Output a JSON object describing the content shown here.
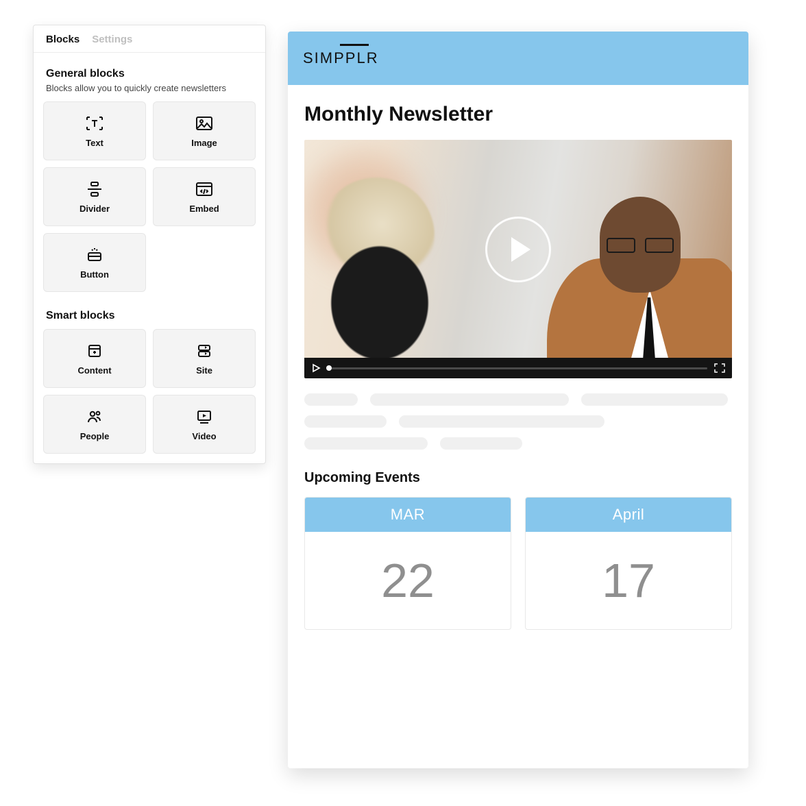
{
  "sidebar": {
    "tabs": {
      "blocks": "Blocks",
      "settings": "Settings"
    },
    "general": {
      "title": "General blocks",
      "desc": "Blocks allow you to quickly create newsletters",
      "items": {
        "text": "Text",
        "image": "Image",
        "divider": "Divider",
        "embed": "Embed",
        "button": "Button"
      }
    },
    "smart": {
      "title": "Smart blocks",
      "items": {
        "content": "Content",
        "site": "Site",
        "people": "People",
        "video": "Video"
      }
    }
  },
  "preview": {
    "brand": "SIMPPLR",
    "title": "Monthly Newsletter",
    "events_title": "Upcoming Events",
    "events": [
      {
        "month": "MAR",
        "day": "22"
      },
      {
        "month": "April",
        "day": "17"
      }
    ]
  },
  "colors": {
    "accent": "#86c6ec"
  }
}
